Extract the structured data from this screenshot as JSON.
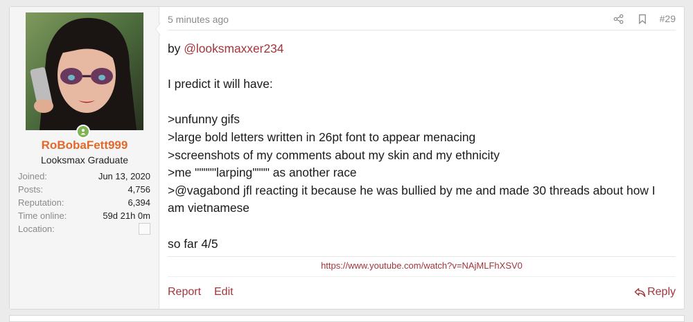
{
  "author": {
    "username": "RoBobaFett999",
    "title": "Looksmax Graduate",
    "status": "online",
    "stats": [
      {
        "label": "Joined:",
        "value": "Jun 13, 2020"
      },
      {
        "label": "Posts:",
        "value": "4,756"
      },
      {
        "label": "Reputation:",
        "value": "6,394"
      },
      {
        "label": "Time online:",
        "value": "59d 21h 0m"
      }
    ],
    "location_label": "Location:"
  },
  "header": {
    "timestamp": "5 minutes ago",
    "post_number": "#29",
    "share_icon": "share-icon",
    "bookmark_icon": "bookmark-icon"
  },
  "content": {
    "by_prefix": "by ",
    "by_mention": "@looksmaxxer234",
    "line_predict": "I predict it will have:",
    "line_1": ">unfunny gifs",
    "line_2": ">large bold letters written in 26pt font to appear menacing",
    "line_3": ">screenshots of my comments about my skin and my ethnicity",
    "line_4": ">me \"\"\"\"\"larping\"\"\"\" as another race",
    "line_5a": ">@vagabond jfl reacting it because he was bullied by me and made 30 threads about how I",
    "line_5b": "am vietnamese",
    "line_score": "so far 4/5"
  },
  "link": {
    "url_text": "https://www.youtube.com/watch?v=NAjMLFhXSV0"
  },
  "footer": {
    "report_label": "Report",
    "edit_label": "Edit",
    "reply_label": "Reply",
    "reply_icon": "reply-arrow-icon"
  },
  "colors": {
    "username": "#e3692b",
    "link": "#a2363b",
    "online": "#7fb356",
    "muted": "#8a8a8a"
  }
}
